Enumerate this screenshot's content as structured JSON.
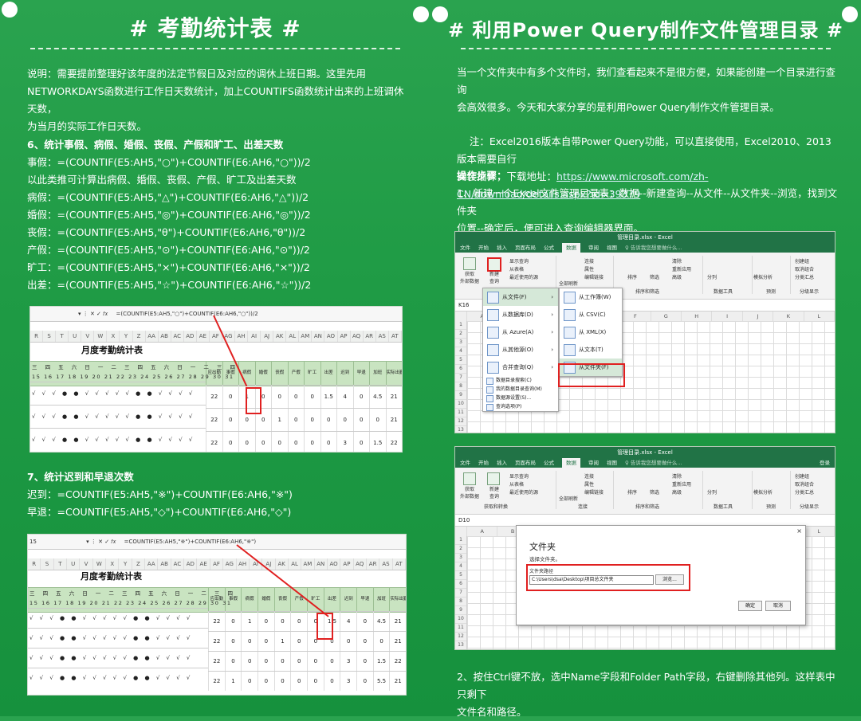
{
  "left": {
    "title": "# 考勤统计表 #",
    "intro": "说明：需要提前整理好该年度的法定节假日及对应的调休上班日期。这里先用\nNETWORKDAYS函数进行工作日天数统计，加上COUNTIFS函数统计出来的上班调休天数，\n为当月的实际工作日天数。",
    "sec6_head": "6、统计事假、病假、婚假、丧假、产假和旷工、出差天数",
    "sec6_lines": [
      "事假：=(COUNTIF(E5:AH5,\"○\")+COUNTIF(E6:AH6,\"○\"))/2",
      "以此类推可计算出病假、婚假、丧假、产假、旷工及出差天数",
      "病假：=(COUNTIF(E5:AH5,\"△\")+COUNTIF(E6:AH6,\"△\"))/2",
      "婚假：=(COUNTIF(E5:AH5,\"◎\")+COUNTIF(E6:AH6,\"◎\"))/2",
      "丧假：=(COUNTIF(E5:AH5,\"θ\")+COUNTIF(E6:AH6,\"θ\"))/2",
      "产假：=(COUNTIF(E5:AH5,\"⊙\")+COUNTIF(E6:AH6,\"⊙\"))/2",
      "旷工：=(COUNTIF(E5:AH5,\"×\")+COUNTIF(E6:AH6,\"×\"))/2",
      "出差：=(COUNTIF(E5:AH5,\"☆\")+COUNTIF(E6:AH6,\"☆\"))/2"
    ],
    "sheet1_formula": "=(COUNTIF(E5:AH5,\"○\")+COUNTIF(E6:AH6,\"○\"))/2",
    "sheet_title": "月度考勤统计表",
    "sec7_head": "7、统计迟到和早退次数",
    "sec7_lines": [
      "迟到：=COUNTIF(E5:AH5,\"※\")+COUNTIF(E6:AH6,\"※\")",
      "早退：=COUNTIF(E5:AH5,\"◇\")+COUNTIF(E6:AH6,\"◇\")"
    ],
    "sheet2_formula": "=COUNTIF(E5:AH5,\"※\")+COUNTIF(E6:AH6,\"※\")",
    "sheet2_ref": "15",
    "col_letters": [
      "R",
      "S",
      "T",
      "U",
      "V",
      "W",
      "X",
      "Y",
      "Z",
      "AA",
      "AB",
      "AC",
      "AD",
      "AE",
      "AF",
      "AG",
      "AH",
      "AI",
      "AJ",
      "AK",
      "AL",
      "AM",
      "AN",
      "AO",
      "AP",
      "AQ",
      "AR",
      "AS",
      "AT"
    ],
    "weekday_row": "三 四 五 六 日 一 二 三 四 五 六 日 一 二 三 四",
    "day_row": "15 16 17 18 19 20 21 22 23 24 25 26 27 28 29 30 31",
    "stat_headers": [
      "应出勤",
      "事假",
      "病假",
      "婚假",
      "丧假",
      "产假",
      "旷工",
      "出差",
      "迟到",
      "早退",
      "加班",
      "实际出勤"
    ],
    "sheet1_rows": [
      [
        "22",
        "0",
        "1",
        "0",
        "0",
        "0",
        "0",
        "1.5",
        "4",
        "0",
        "4.5",
        "21"
      ],
      [
        "22",
        "0",
        "0",
        "0",
        "1",
        "0",
        "0",
        "0",
        "0",
        "0",
        "0",
        "21"
      ],
      [
        "22",
        "0",
        "0",
        "0",
        "0",
        "0",
        "0",
        "0",
        "3",
        "0",
        "1.5",
        "22"
      ]
    ],
    "sheet2_rows": [
      [
        "22",
        "0",
        "1",
        "0",
        "0",
        "0",
        "0",
        "1.5",
        "4",
        "0",
        "4.5",
        "21"
      ],
      [
        "22",
        "0",
        "0",
        "0",
        "1",
        "0",
        "0",
        "0",
        "0",
        "0",
        "0",
        "21"
      ],
      [
        "22",
        "0",
        "0",
        "0",
        "0",
        "0",
        "0",
        "0",
        "3",
        "0",
        "1.5",
        "22"
      ],
      [
        "22",
        "1",
        "0",
        "0",
        "0",
        "0",
        "0",
        "0",
        "3",
        "0",
        "5.5",
        "21"
      ]
    ]
  },
  "right": {
    "title": "# 利用Power Query制作文件管理目录 #",
    "intro": "当一个文件夹中有多个文件时，我们查看起来不是很方便，如果能创建一个目录进行查询\n会高效很多。今天和大家分享的是利用Power Query制作文件管理目录。",
    "note": "注：Excel2016版本自带Power Query功能，可以直接使用，Excel2010、2013版本需要自行\n安装插件，下载地址：",
    "note_link": "https://www.microsoft.com/zh-CN/download/details.aspx?id=39379",
    "steps_head": "操作步骤：",
    "step1": "1、新建一个Excel文件管理目录表：数据--新建查询--从文件--从文件夹--浏览，找到文件夹\n位置--确定后，便可进入查询编辑器界面。",
    "step2": "2、按住Ctrl键不放，选中Name字段和Folder Path字段，右键删除其他列。这样表中只剩下\n文件名和路径。",
    "xl_title": "管理目录.xlsx - Excel",
    "xl_tabs": [
      "文件",
      "开始",
      "插入",
      "页面布局",
      "公式",
      "数据",
      "审阅",
      "视图"
    ],
    "xl_tell": "♀ 告诉我您想要做什么...",
    "xl_login": "登录",
    "ribbon_labels": {
      "get_ext": "获取\n外部数据",
      "new_query": "新建\n查询",
      "show_query": "显示查询",
      "from_table": "从表格",
      "recent": "最近使用的源",
      "get_transform": "获取和转换",
      "refresh_all": "全部刷新",
      "connections": "连接",
      "properties": "属性",
      "edit_links": "编辑链接",
      "conn_group": "连接",
      "sort": "排序",
      "filter": "筛选",
      "clear": "清除",
      "reapply": "重新应用",
      "advanced": "高级",
      "sort_filter": "排序和筛选",
      "text_cols": "分列",
      "data_tools": "数据工具",
      "whatif": "模拟分析",
      "forecast": "预测\n工作表",
      "forecast_g": "预测",
      "group": "创建组",
      "ungroup": "取消组合",
      "subtotal": "分类汇总",
      "outline": "分级显示"
    },
    "cell_ref1": "K16",
    "cell_ref2": "D10",
    "xl_cols1": [
      "A",
      "B",
      "C",
      "D",
      "E",
      "F",
      "G",
      "H",
      "I",
      "J",
      "K",
      "L"
    ],
    "xl_cols2": [
      "A",
      "B",
      "C",
      "D",
      "E",
      "F",
      "G",
      "H",
      "I",
      "J",
      "K",
      "L"
    ],
    "menu_main": [
      {
        "label": "从文件(F)",
        "selected": true,
        "arrow": true
      },
      {
        "label": "从数据库(D)",
        "selected": false,
        "arrow": true
      },
      {
        "label": "从 Azure(A)",
        "selected": false,
        "arrow": true
      },
      {
        "label": "从其他源(O)",
        "selected": false,
        "arrow": true
      },
      {
        "label": "合并查询(Q)",
        "selected": false,
        "arrow": true
      }
    ],
    "menu_small": [
      "数据目录搜索(C)",
      "我的数据目录查询(M)",
      "数据源设置(S)...",
      "查询选项(P)"
    ],
    "menu_sub": [
      "从工作簿(W)",
      "从 CSV(C)",
      "从 XML(X)",
      "从文本(T)",
      "从文件夹(F)"
    ],
    "dialog_title": "文件夹",
    "dialog_sub": "选择文件夹。",
    "dialog_path_label": "文件夹路径",
    "dialog_path": "C:\\Users\\dsa\\Desktop\\项目总文件夹",
    "browse": "浏览...",
    "ok": "确定",
    "cancel": "取消"
  },
  "colors": {
    "bg": "#1f9b45",
    "excel_green": "#217346",
    "highlight": "#e02020",
    "sheet_header": "#c9e4c1"
  }
}
